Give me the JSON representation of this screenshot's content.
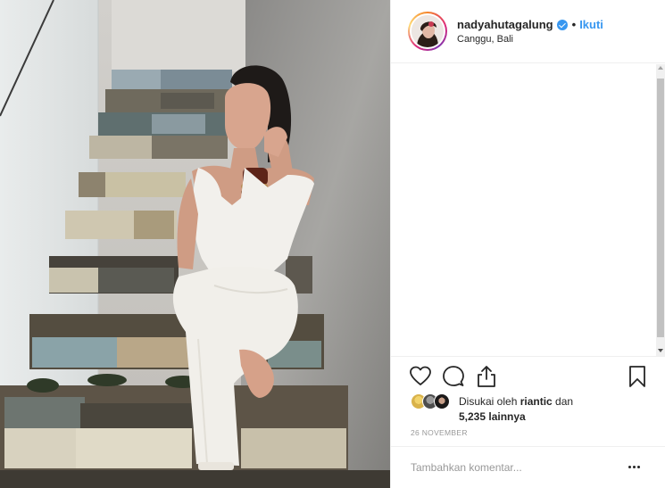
{
  "post": {
    "username": "nadyahutagalung",
    "separator": "•",
    "follow_label": "Ikuti",
    "location": "Canggu, Bali",
    "likes": {
      "prefix": "Disukai oleh ",
      "user": "riantic",
      "middle": " dan",
      "count_text": "5,235 lainnya"
    },
    "timestamp": "26 NOVEMBER",
    "comment_placeholder": "Tambahkan komentar...",
    "accent_color": "#3897f0"
  },
  "icons": {
    "verified": "verified-badge-icon",
    "like": "heart-icon",
    "comment": "comment-bubble-icon",
    "share": "share-icon",
    "save": "bookmark-icon",
    "more": "more-options-icon"
  }
}
